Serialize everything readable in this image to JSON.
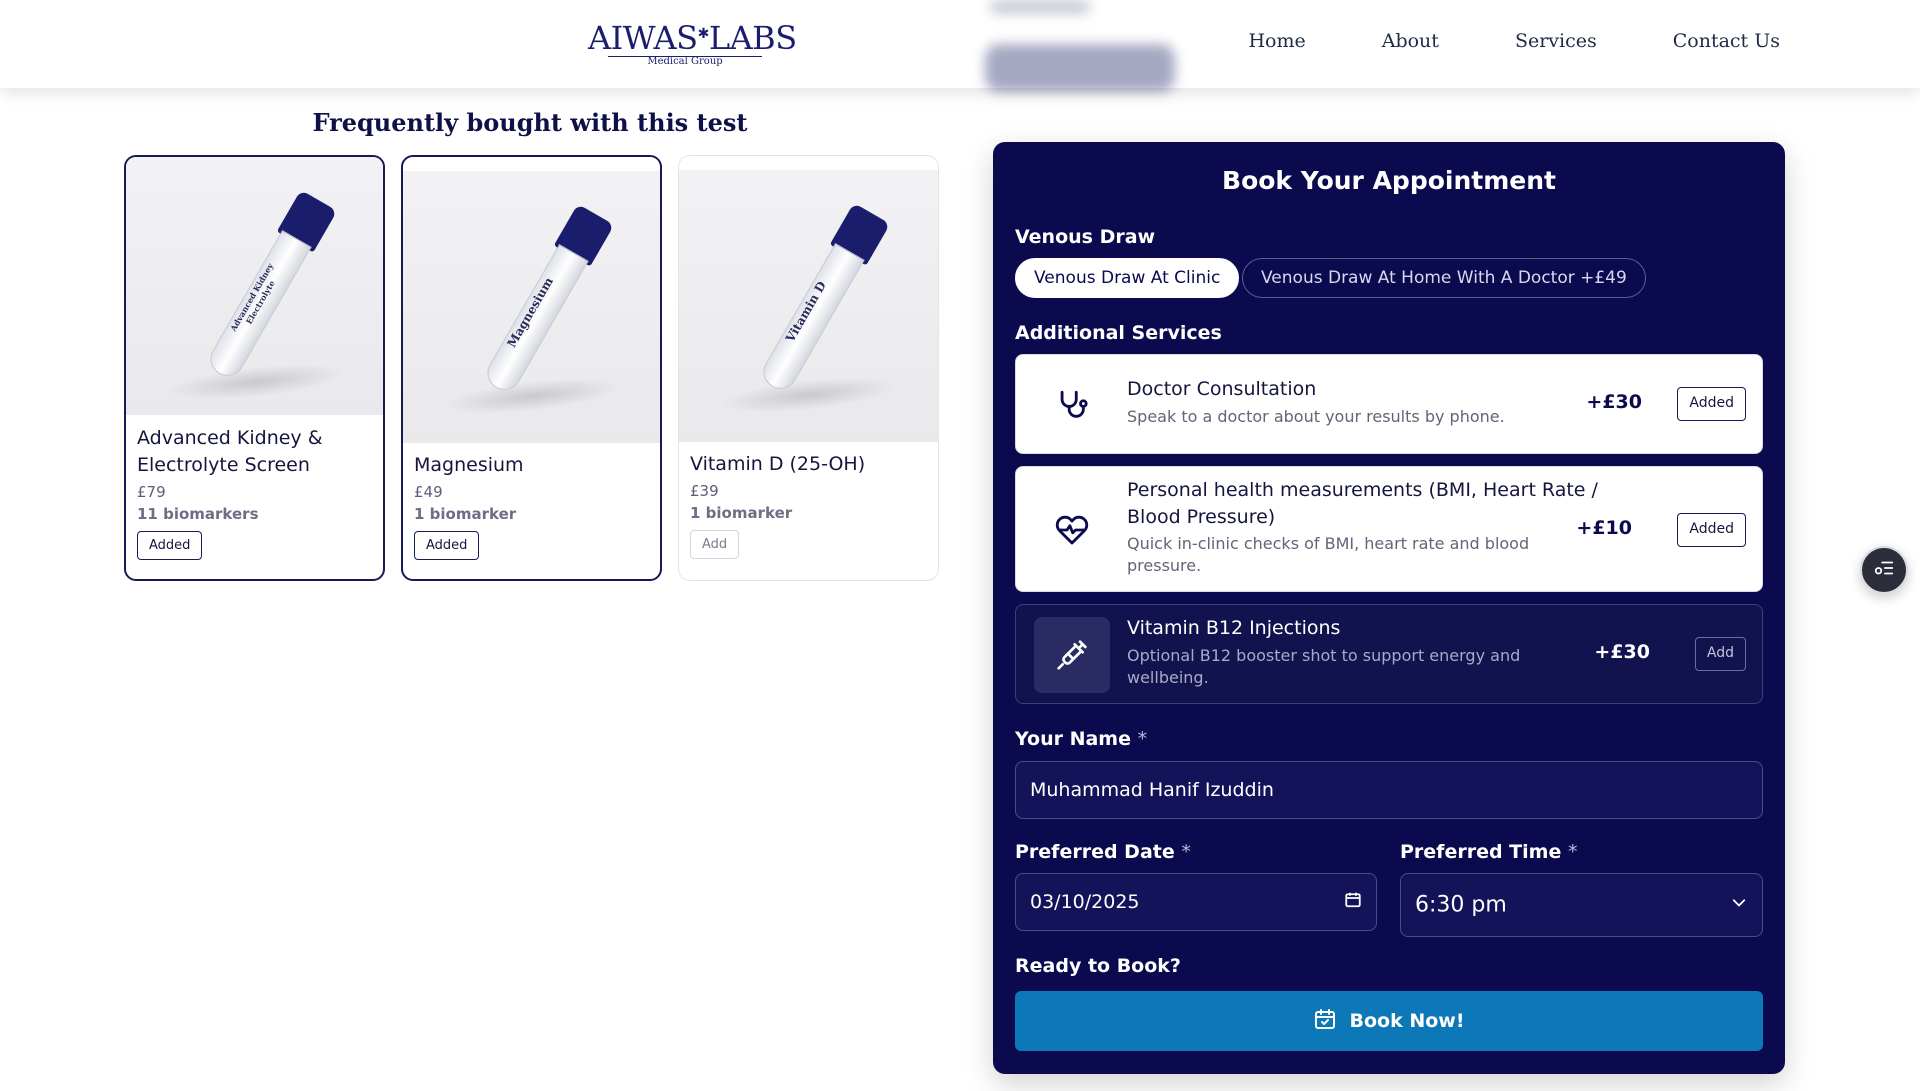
{
  "brand": {
    "logo_main": "AIWAS",
    "logo_main_2": "LABS",
    "logo_sub": "Medical Group"
  },
  "nav": {
    "home": "Home",
    "about": "About",
    "services": "Services",
    "contact": "Contact Us"
  },
  "frequently_bought": {
    "title": "Frequently bought with this test",
    "items": [
      {
        "name": "Advanced Kidney & Electrolyte Screen",
        "price": "£79",
        "biomarkers": "11 biomarkers",
        "button": "Added",
        "tube_label": "Advanced Kidney Electrolyte"
      },
      {
        "name": "Magnesium",
        "price": "£49",
        "biomarkers": "1 biomarker",
        "button": "Added",
        "tube_label": "Magnesium"
      },
      {
        "name": "Vitamin D (25-OH)",
        "price": "£39",
        "biomarkers": "1 biomarker",
        "button": "Add",
        "tube_label": "Vitamin D"
      }
    ]
  },
  "booking": {
    "title": "Book Your Appointment",
    "venous_label": "Venous Draw",
    "venous_options": [
      "Venous Draw At Clinic",
      "Venous Draw At Home With A Doctor +£49"
    ],
    "additional_label": "Additional Services",
    "services": [
      {
        "title": "Doctor Consultation",
        "desc": "Speak to a doctor about your results by phone.",
        "price": "+£30",
        "button": "Added",
        "icon": "stethoscope-icon"
      },
      {
        "title": "Personal health measurements (BMI, Heart Rate / Blood Pressure)",
        "desc": "Quick in-clinic checks of BMI, heart rate and blood pressure.",
        "price": "+£10",
        "button": "Added",
        "icon": "heart-pulse-icon"
      },
      {
        "title": "Vitamin B12 Injections",
        "desc": "Optional B12 booster shot to support energy and wellbeing.",
        "price": "+£30",
        "button": "Add",
        "icon": "syringe-icon"
      }
    ],
    "name_label": "Your Name",
    "name_value": "Muhammad Hanif Izuddin",
    "date_label": "Preferred Date",
    "date_value": "03/10/2025",
    "time_label": "Preferred Time",
    "time_value": "6:30 pm",
    "required_mark": "*",
    "ready_label": "Ready to Book?",
    "book_button": "Book Now!"
  },
  "colors": {
    "panel_bg": "#0b0a4e",
    "book_button": "#0d78b7",
    "accent": "#161a57"
  }
}
